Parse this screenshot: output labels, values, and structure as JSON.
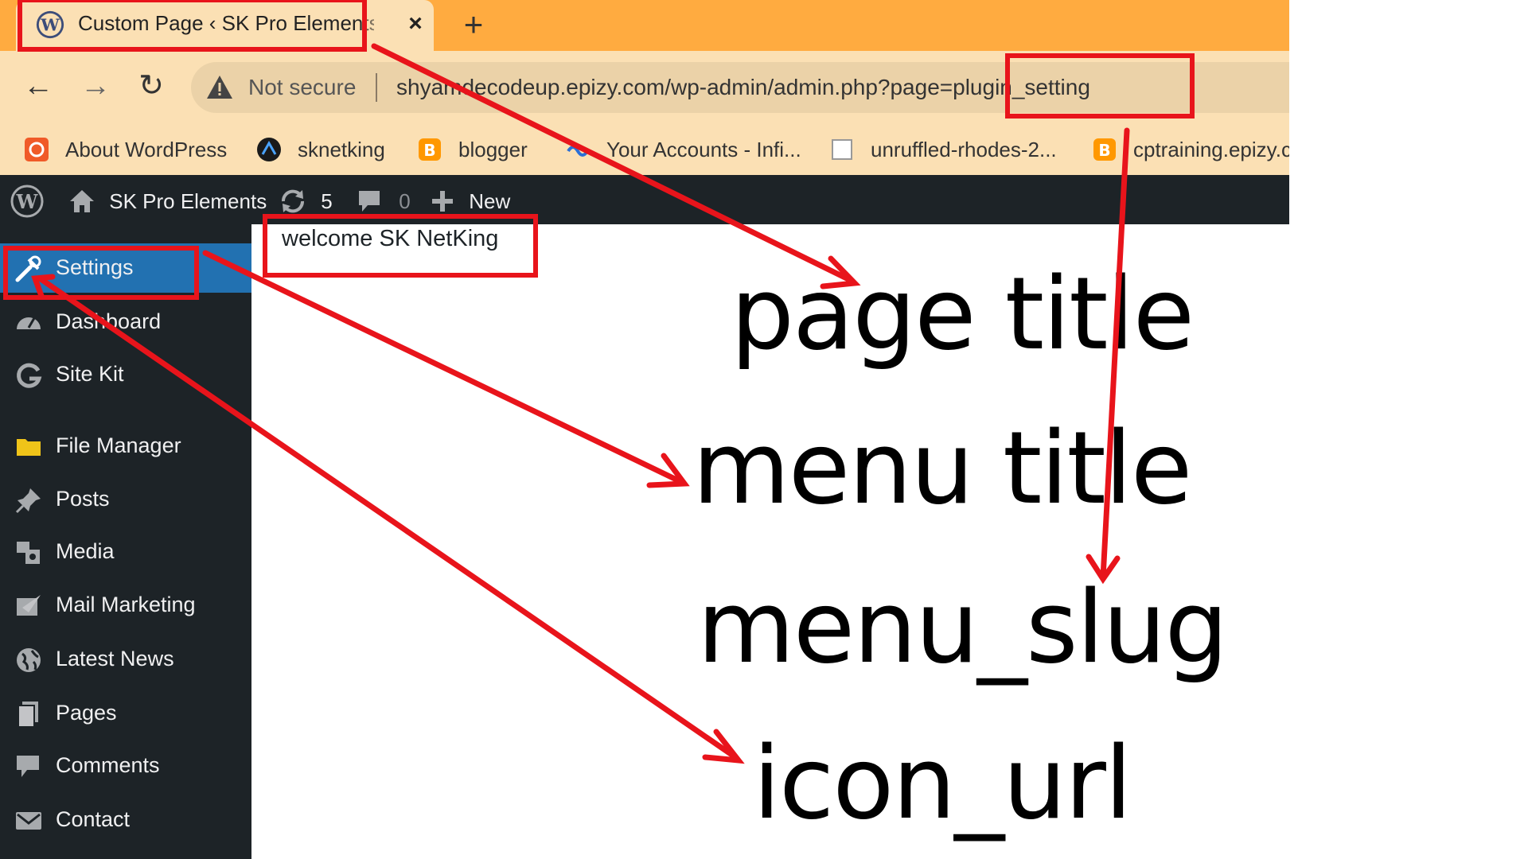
{
  "browser": {
    "tab_title": "Custom Page ‹ SK Pro Elements",
    "tab_close": "×",
    "new_tab": "+",
    "nav": {
      "back": "←",
      "forward": "→",
      "reload": "↻"
    },
    "security_label": "Not secure",
    "url": "shyamdecodeup.epizy.com/wp-admin/admin.php?page=plugin_setting",
    "bookmarks": [
      "About WordPress",
      "sknetking",
      "blogger",
      "Your Accounts - Infi...",
      "unruffled-rhodes-2...",
      "cptraining.epizy.c"
    ]
  },
  "admin_bar": {
    "site_name": "SK Pro Elements",
    "updates_count": "5",
    "comments_count": "0",
    "new_label": "New"
  },
  "sidebar": {
    "items": [
      "Settings",
      "Dashboard",
      "Site Kit",
      "File Manager",
      "Posts",
      "Media",
      "Mail Marketing",
      "Latest News",
      "Pages",
      "Comments",
      "Contact"
    ]
  },
  "content": {
    "welcome_text": "welcome SK NetKing"
  },
  "annotations": {
    "page_title": "page title",
    "menu_title": "menu title",
    "menu_slug": "menu_slug",
    "icon_url": "icon_url"
  },
  "colors": {
    "tab_strip": "#ffab40",
    "toolbar": "#fbe0b4",
    "admin_dark": "#1d2327",
    "wp_blue": "#2271b1",
    "annotation_red": "#e8141b"
  }
}
